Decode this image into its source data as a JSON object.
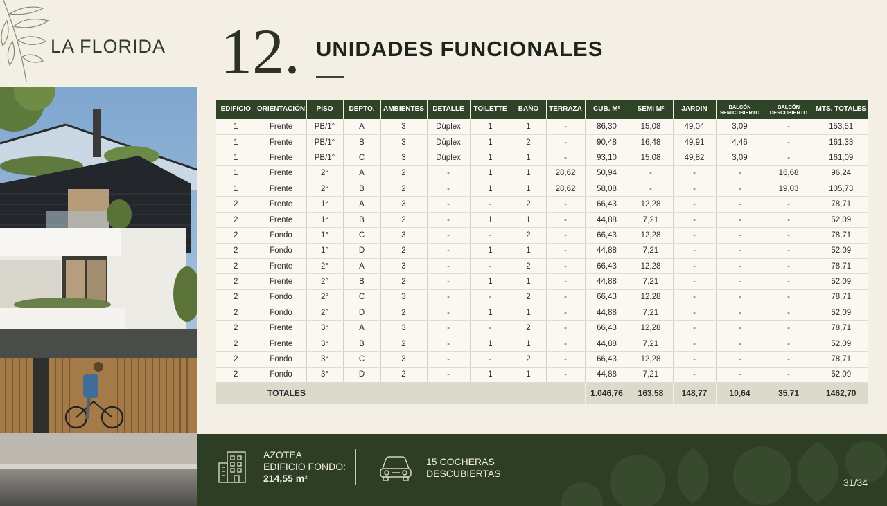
{
  "brand": "LA FLORIDA",
  "section": {
    "number": "12.",
    "title": "UNIDADES FUNCIONALES"
  },
  "table": {
    "headers": [
      {
        "lines": [
          "EDIFICIO"
        ]
      },
      {
        "lines": [
          "ORIENTACIÓN"
        ]
      },
      {
        "lines": [
          "PISO"
        ]
      },
      {
        "lines": [
          "DEPTO."
        ]
      },
      {
        "lines": [
          "AMBIENTES"
        ]
      },
      {
        "lines": [
          "DETALLE"
        ]
      },
      {
        "lines": [
          "TOILETTE"
        ]
      },
      {
        "lines": [
          "BAÑO"
        ]
      },
      {
        "lines": [
          "TERRAZA"
        ]
      },
      {
        "lines": [
          "CUB. M²"
        ]
      },
      {
        "lines": [
          "SEMI M²"
        ]
      },
      {
        "lines": [
          "JARDÍN"
        ]
      },
      {
        "lines": [
          "BALCÓN",
          "SEMICUBIERTO"
        ],
        "small": true
      },
      {
        "lines": [
          "BALCÓN",
          "DESCUBIERTO"
        ],
        "small": true
      },
      {
        "lines": [
          "MTS. TOTALES"
        ]
      }
    ],
    "rows": [
      [
        "1",
        "Frente",
        "PB/1°",
        "A",
        "3",
        "Dúplex",
        "1",
        "1",
        "-",
        "86,30",
        "15,08",
        "49,04",
        "3,09",
        "-",
        "153,51"
      ],
      [
        "1",
        "Frente",
        "PB/1°",
        "B",
        "3",
        "Dúplex",
        "1",
        "2",
        "-",
        "90,48",
        "16,48",
        "49,91",
        "4,46",
        "-",
        "161,33"
      ],
      [
        "1",
        "Frente",
        "PB/1°",
        "C",
        "3",
        "Dúplex",
        "1",
        "1",
        "-",
        "93,10",
        "15,08",
        "49,82",
        "3,09",
        "-",
        "161,09"
      ],
      [
        "1",
        "Frente",
        "2°",
        "A",
        "2",
        "-",
        "1",
        "1",
        "28,62",
        "50,94",
        "-",
        "-",
        "-",
        "16,68",
        "96,24"
      ],
      [
        "1",
        "Frente",
        "2°",
        "B",
        "2",
        "-",
        "1",
        "1",
        "28,62",
        "58,08",
        "-",
        "-",
        "-",
        "19,03",
        "105,73"
      ],
      [
        "2",
        "Frente",
        "1°",
        "A",
        "3",
        "-",
        "-",
        "2",
        "-",
        "66,43",
        "12,28",
        "-",
        "-",
        "-",
        "78,71"
      ],
      [
        "2",
        "Frente",
        "1°",
        "B",
        "2",
        "-",
        "1",
        "1",
        "-",
        "44,88",
        "7,21",
        "-",
        "-",
        "-",
        "52,09"
      ],
      [
        "2",
        "Fondo",
        "1°",
        "C",
        "3",
        "-",
        "-",
        "2",
        "-",
        "66,43",
        "12,28",
        "-",
        "-",
        "-",
        "78,71"
      ],
      [
        "2",
        "Fondo",
        "1°",
        "D",
        "2",
        "-",
        "1",
        "1",
        "-",
        "44,88",
        "7,21",
        "-",
        "-",
        "-",
        "52,09"
      ],
      [
        "2",
        "Frente",
        "2°",
        "A",
        "3",
        "-",
        "-",
        "2",
        "-",
        "66,43",
        "12,28",
        "-",
        "-",
        "-",
        "78,71"
      ],
      [
        "2",
        "Frente",
        "2°",
        "B",
        "2",
        "-",
        "1",
        "1",
        "-",
        "44,88",
        "7,21",
        "-",
        "-",
        "-",
        "52,09"
      ],
      [
        "2",
        "Fondo",
        "2°",
        "C",
        "3",
        "-",
        "-",
        "2",
        "-",
        "66,43",
        "12,28",
        "-",
        "-",
        "-",
        "78,71"
      ],
      [
        "2",
        "Fondo",
        "2°",
        "D",
        "2",
        "-",
        "1",
        "1",
        "-",
        "44,88",
        "7,21",
        "-",
        "-",
        "-",
        "52,09"
      ],
      [
        "2",
        "Frente",
        "3°",
        "A",
        "3",
        "-",
        "-",
        "2",
        "-",
        "66,43",
        "12,28",
        "-",
        "-",
        "-",
        "78,71"
      ],
      [
        "2",
        "Frente",
        "3°",
        "B",
        "2",
        "-",
        "1",
        "1",
        "-",
        "44,88",
        "7,21",
        "-",
        "-",
        "-",
        "52,09"
      ],
      [
        "2",
        "Fondo",
        "3°",
        "C",
        "3",
        "-",
        "-",
        "2",
        "-",
        "66,43",
        "12,28",
        "-",
        "-",
        "-",
        "78,71"
      ],
      [
        "2",
        "Fondo",
        "3°",
        "D",
        "2",
        "-",
        "1",
        "1",
        "-",
        "44,88",
        "7,21",
        "-",
        "-",
        "-",
        "52,09"
      ]
    ],
    "totals": {
      "label": "TOTALES",
      "cub": "1.046,76",
      "semi": "163,58",
      "jardin": "148,77",
      "balcon_semi": "10,64",
      "balcon_desc": "35,71",
      "mts_totales": "1462,70"
    }
  },
  "footer": {
    "azotea_line1": "AZOTEA",
    "azotea_line2": "EDIFICIO FONDO:",
    "azotea_value": "214,55 m²",
    "cocheras_line1": "15 COCHERAS",
    "cocheras_line2": "DESCUBIERTAS",
    "page": "31/34"
  },
  "colors": {
    "accent_green": "#2f4326",
    "footer_green": "#2e3e24",
    "background": "#f3efe4"
  },
  "icons": [
    "leaf-branch-icon",
    "building-icon",
    "car-icon"
  ]
}
